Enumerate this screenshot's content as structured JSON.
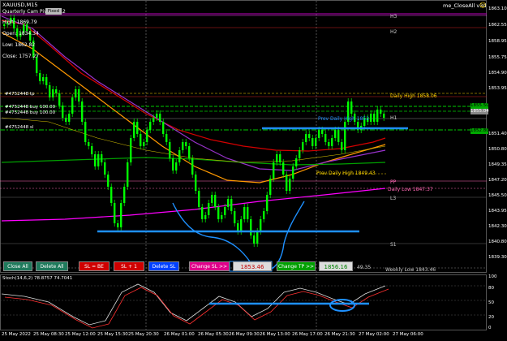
{
  "chart": {
    "symbol_line": "XAUUSD,M15",
    "indicator_name": "Quarterly Cam Pivot 2.7.2",
    "flag_label": "Fixed",
    "info_lines": [
      "High: 1869.79",
      "Open: 1834.34",
      "Low: 1862.82",
      "Close: 1757.27"
    ],
    "expert_label": "me_CloseAll v3d",
    "expert_icon": "smiley-icon",
    "order_labels": [
      "#4752448 tp",
      "#4752448 buy 100.00",
      "#4752448 buy 100.00",
      "#4752448 sl"
    ],
    "price_axis": [
      "1863.10",
      "1862.55",
      "1858.95",
      "1855.75",
      "1854.90",
      "1853.95",
      "1851.40",
      "1850.80",
      "1849.35",
      "1847.20",
      "1845.50",
      "1843.95",
      "1842.30",
      "1840.80",
      "1839.30"
    ],
    "price_tags": [
      {
        "text": "1855.50",
        "color": "#00aa00"
      },
      {
        "text": "1855.04",
        "color": "#7a7a7a"
      },
      {
        "text": "1852.80",
        "color": "#00aa00"
      }
    ],
    "time_axis": [
      "25 May 2022",
      "25 May 08:30",
      "25 May 12:00",
      "25 May 15:30",
      "25 May 20:30",
      "26 May 01:00",
      "26 May 05:30",
      "26 May 09:30",
      "26 May 13:00",
      "26 May 17:00",
      "26 May 21:30",
      "27 May 02:00",
      "27 May 06:00"
    ],
    "pivot_labels": {
      "h3": "H3",
      "h2": "H2",
      "h1": "H1",
      "pp": "PP",
      "l3": "L3",
      "s1": "S1",
      "daily_high": "Daily High 1858.06",
      "prev_daily_high": "Prev Daily High 1852",
      "prev_daily_low": "Prev Daily High 1849.43",
      "daily_low": "Daily Low 1847.37",
      "weekly_low": "Weekly Low 1843.46",
      "r1": "R1"
    },
    "colors": {
      "candles": "#00ff00",
      "ma_red": "#d40000",
      "ma_orange": "#ff9900",
      "ma_purple": "#9932cc",
      "ma_green": "#00a000",
      "ma_magenta": "#ff00ff",
      "drawing": "#1e90ff"
    }
  },
  "toolbar": {
    "close_all": "Close All",
    "delete_all": "Delete All",
    "sl_be": "SL = BE",
    "sl_plus1": "SL + 1",
    "delete_sl": "Delete SL",
    "change_sl": "Change SL >>",
    "sl_value": "1853.46",
    "change_tp": "Change TP >>",
    "tp_value": "1856.16",
    "aux_value": "49.35"
  },
  "stoch": {
    "label": "Stoch(14,6,2) 78.8757 74.7041",
    "levels": [
      "100",
      "80",
      "50",
      "20",
      "0"
    ]
  }
}
